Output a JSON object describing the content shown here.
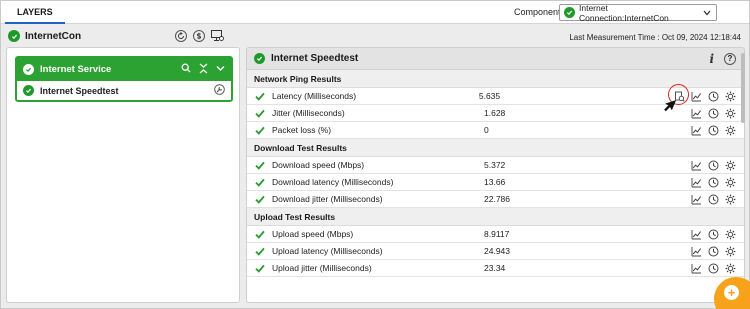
{
  "header": {
    "tab_label": "LAYERS",
    "component_label": "Component",
    "component_value": "Internet Connection:InternetCon"
  },
  "host": {
    "title": "InternetCon",
    "last_measurement": "Last Measurement Time : Oct 09, 2024 12:18:44"
  },
  "layer": {
    "group_name": "Internet Service",
    "item_name": "Internet Speedtest"
  },
  "test": {
    "title": "Internet Speedtest",
    "info_glyph": "i",
    "help_glyph": "?",
    "sections": [
      {
        "title": "Network Ping Results",
        "rows": [
          {
            "name": "Latency (Milliseconds)",
            "value": "5.635"
          },
          {
            "name": "Jitter (Milliseconds)",
            "value": "1.628"
          },
          {
            "name": "Packet loss (%)",
            "value": "0"
          }
        ]
      },
      {
        "title": "Download Test Results",
        "rows": [
          {
            "name": "Download speed (Mbps)",
            "value": "5.372"
          },
          {
            "name": "Download latency (Milliseconds)",
            "value": "13.66"
          },
          {
            "name": "Download jitter (Milliseconds)",
            "value": "22.786"
          }
        ]
      },
      {
        "title": "Upload Test Results",
        "rows": [
          {
            "name": "Upload speed (Mbps)",
            "value": "8.9117"
          },
          {
            "name": "Upload latency (Milliseconds)",
            "value": "24.943"
          },
          {
            "name": "Upload jitter (Milliseconds)",
            "value": "23.34"
          }
        ]
      }
    ]
  },
  "fab": {
    "glyph": "+"
  },
  "colors": {
    "status_green": "#1e9a2a",
    "group_green": "#2ba232",
    "accent_orange": "#f6a31b",
    "tab_blue": "#1e62c4"
  }
}
